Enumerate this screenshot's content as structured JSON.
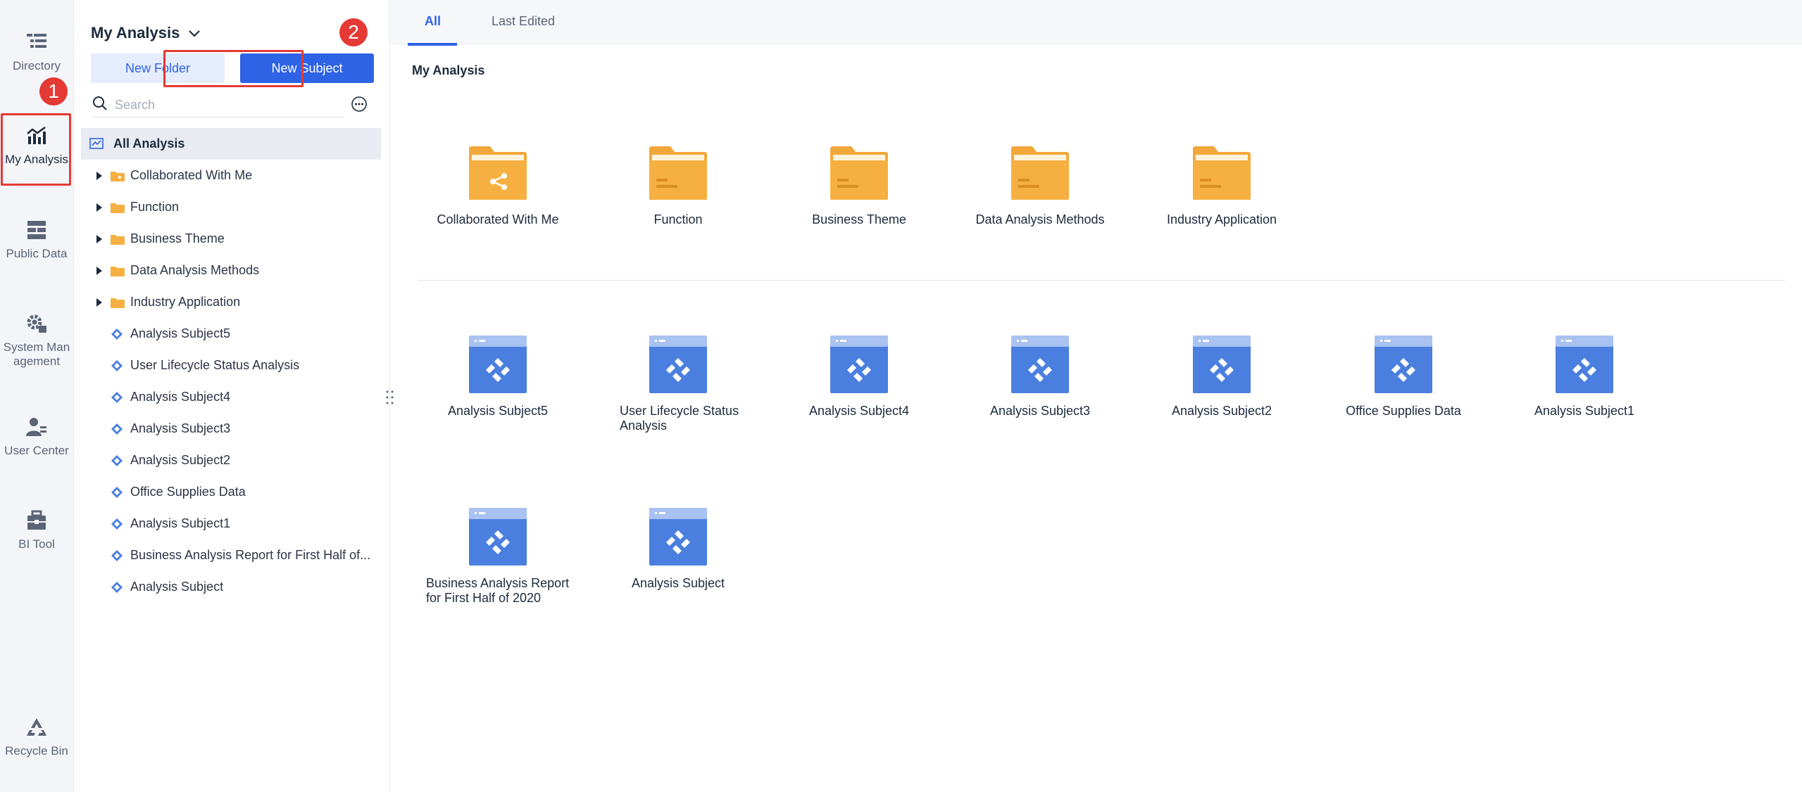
{
  "rail": {
    "items": [
      {
        "label": "Directory",
        "icon": "directory-icon"
      },
      {
        "label": "My Analysis",
        "icon": "my-analysis-icon"
      },
      {
        "label": "Public Data",
        "icon": "public-data-icon"
      },
      {
        "label": "System Management",
        "icon": "system-management-icon"
      },
      {
        "label": "User Center",
        "icon": "user-center-icon"
      },
      {
        "label": "BI Tool",
        "icon": "bi-tool-icon"
      },
      {
        "label": "Recycle Bin",
        "icon": "recycle-bin-icon"
      }
    ],
    "system_label_line1": "System Man",
    "system_label_line2": "agement"
  },
  "annotations": {
    "badge1": "1",
    "badge2": "2",
    "highlight_color": "#e53935"
  },
  "tree": {
    "title": "My Analysis",
    "new_folder": "New Folder",
    "new_subject": "New Subject",
    "search_placeholder": "Search",
    "all_label": "All Analysis",
    "folders": [
      "Collaborated With Me",
      "Function",
      "Business Theme",
      "Data Analysis Methods",
      "Industry Application"
    ],
    "subjects": [
      "Analysis Subject5",
      "User Lifecycle Status Analysis",
      "Analysis Subject4",
      "Analysis Subject3",
      "Analysis Subject2",
      "Office Supplies Data",
      "Analysis Subject1",
      "Business Analysis Report for First Half of...",
      "Analysis Subject"
    ]
  },
  "main": {
    "tabs": [
      "All",
      "Last Edited"
    ],
    "section_title": "My Analysis",
    "folder_tiles": [
      "Collaborated With Me",
      "Function",
      "Business Theme",
      "Data Analysis Methods",
      "Industry Application"
    ],
    "subject_tiles": [
      "Analysis Subject5",
      "User Lifecycle Status Analysis",
      "Analysis Subject4",
      "Analysis Subject3",
      "Analysis Subject2",
      "Office Supplies Data",
      "Analysis Subject1",
      "Business Analysis Report for First Half of 2020",
      "Analysis Subject"
    ]
  },
  "colors": {
    "accent": "#2f63e6",
    "folder": "#f5b041",
    "subject_tile": "#4a7fe0"
  }
}
